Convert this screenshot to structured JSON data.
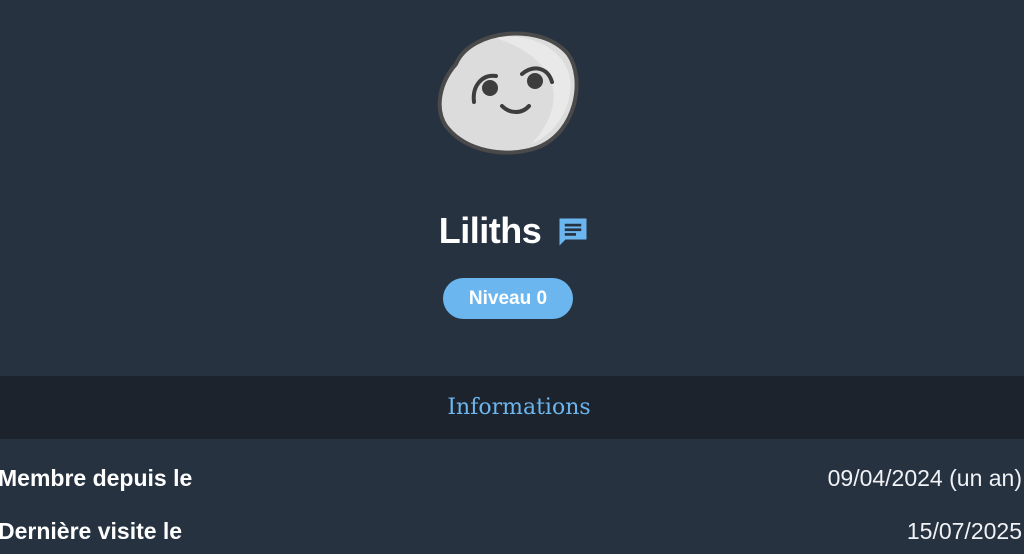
{
  "profile": {
    "username": "Liliths",
    "level_badge": "Niveau 0",
    "avatar_icon": "smiling-face-avatar",
    "message_icon": "chat-message-icon",
    "accent_color": "#6cb6f0"
  },
  "info_section": {
    "title": "Informations",
    "rows": [
      {
        "label": "Membre depuis le",
        "value": "09/04/2024 (un an)"
      },
      {
        "label": "Dernière visite le",
        "value": "15/07/2025"
      }
    ]
  }
}
